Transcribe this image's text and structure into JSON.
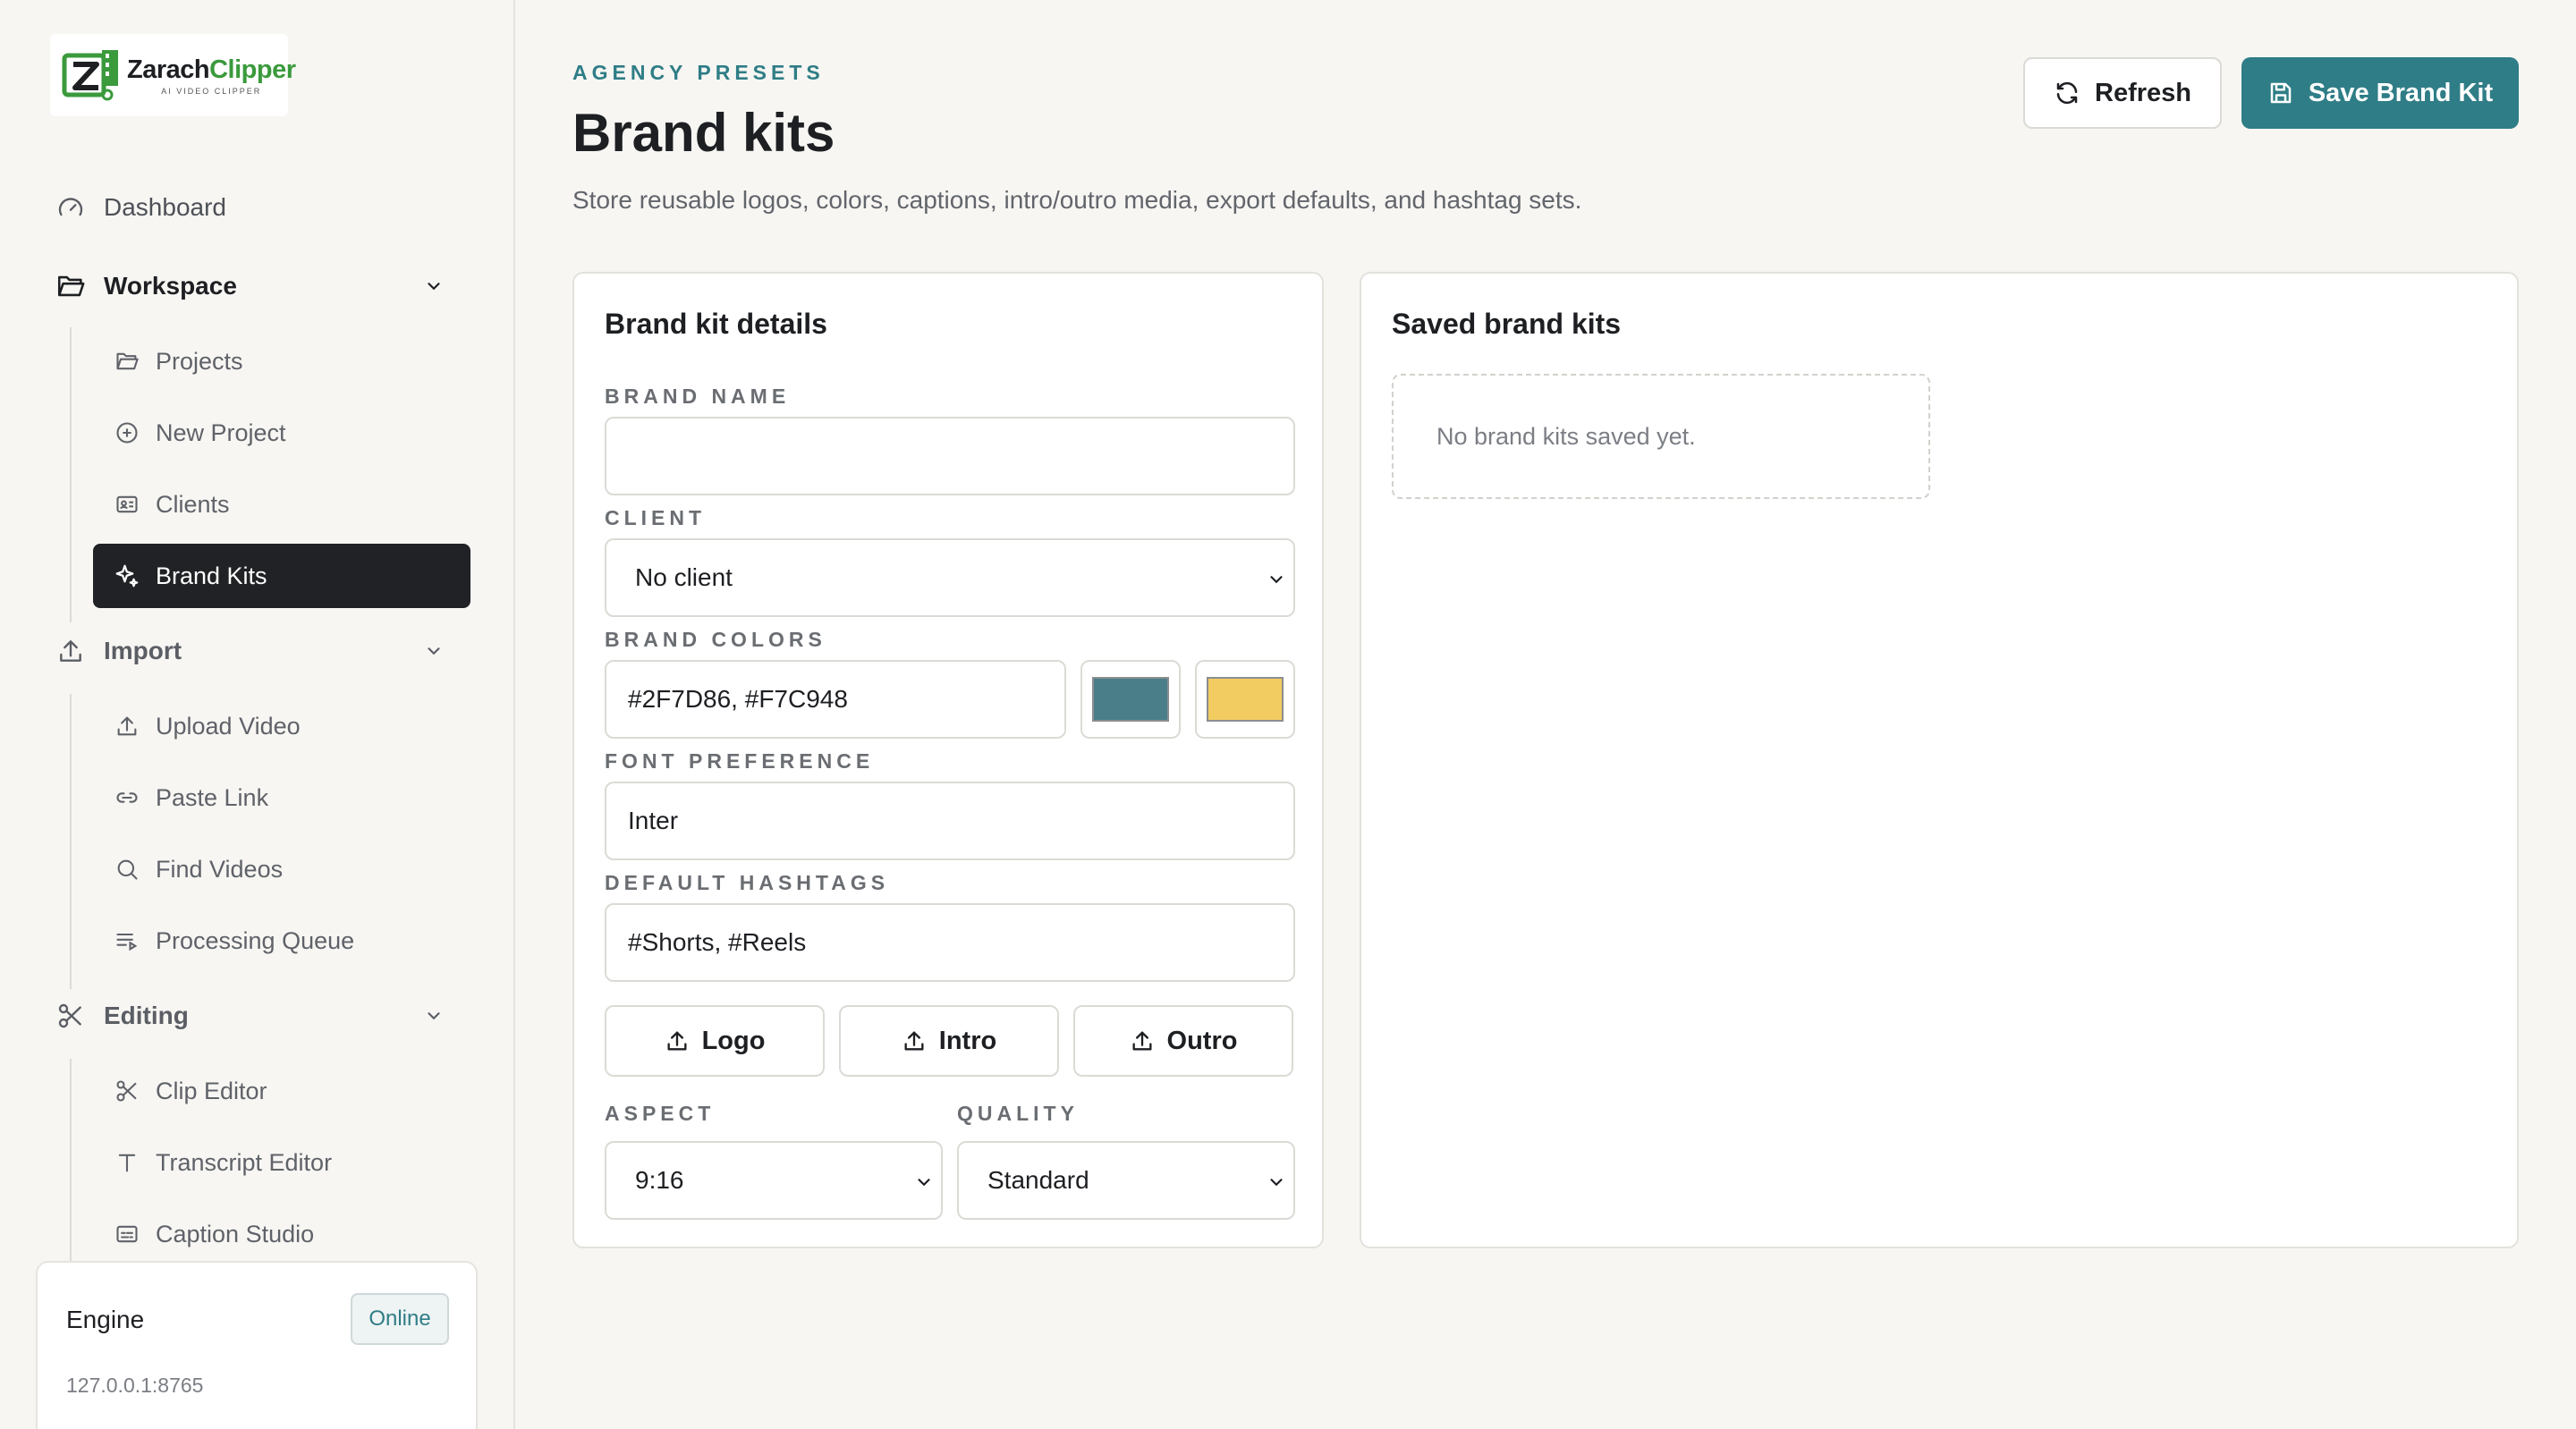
{
  "brand": {
    "name_part1": "Zarach",
    "name_part2": "Clipper",
    "tagline": "AI VIDEO CLIPPER"
  },
  "nav": {
    "dashboard": "Dashboard",
    "workspace": {
      "label": "Workspace",
      "items": [
        "Projects",
        "New Project",
        "Clients",
        "Brand Kits"
      ]
    },
    "import": {
      "label": "Import",
      "items": [
        "Upload Video",
        "Paste Link",
        "Find Videos",
        "Processing Queue"
      ]
    },
    "editing": {
      "label": "Editing",
      "items": [
        "Clip Editor",
        "Transcript Editor",
        "Caption Studio"
      ]
    },
    "active": "Brand Kits"
  },
  "engine": {
    "title": "Engine",
    "status": "Online",
    "address": "127.0.0.1:8765"
  },
  "header": {
    "eyebrow": "AGENCY PRESETS",
    "title": "Brand kits",
    "subtitle": "Store reusable logos, colors, captions, intro/outro media, export defaults, and hashtag sets.",
    "refresh_label": "Refresh",
    "save_label": "Save Brand Kit"
  },
  "form": {
    "title": "Brand kit details",
    "brand_name_label": "BRAND NAME",
    "brand_name_value": "",
    "client_label": "CLIENT",
    "client_value": "No client",
    "colors_label": "BRAND COLORS",
    "colors_value": "#2F7D86, #F7C948",
    "color1": "#4a7f8a",
    "color2": "#f2cc61",
    "font_label": "FONT PREFERENCE",
    "font_value": "Inter",
    "hashtags_label": "DEFAULT HASHTAGS",
    "hashtags_value": "#Shorts, #Reels",
    "upload_logo": "Logo",
    "upload_intro": "Intro",
    "upload_outro": "Outro",
    "aspect_label": "ASPECT",
    "aspect_value": "9:16",
    "quality_label": "QUALITY",
    "quality_value": "Standard"
  },
  "saved": {
    "title": "Saved brand kits",
    "empty_text": "No brand kits saved yet."
  },
  "colors": {
    "accent": "#2f7d86",
    "active_nav": "#202225",
    "background": "#f7f6f3"
  }
}
